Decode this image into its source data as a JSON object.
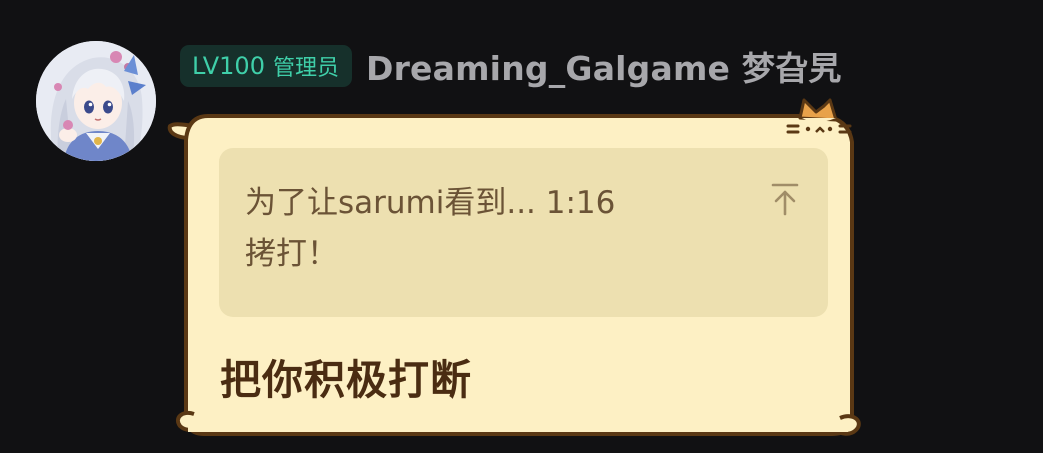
{
  "user": {
    "level": "LV100",
    "role": "管理员",
    "name": "Dreaming_Galgame 梦旮旯",
    "avatar_icon": "anime-girl-avatar"
  },
  "message": {
    "quote": {
      "line1": "为了让sarumi看到... 1:16",
      "line2": "拷打！",
      "jump_icon": "jump-to-top-icon"
    },
    "text": "把你积极打断"
  },
  "colors": {
    "background": "#111113",
    "bubble_fill": "#fdf0c4",
    "bubble_border": "#5a3814",
    "quote_fill": "#ede0b0",
    "level_badge_bg": "#16302b",
    "level_badge_text": "#3fcfa9",
    "username_text": "#a7a7ab"
  }
}
